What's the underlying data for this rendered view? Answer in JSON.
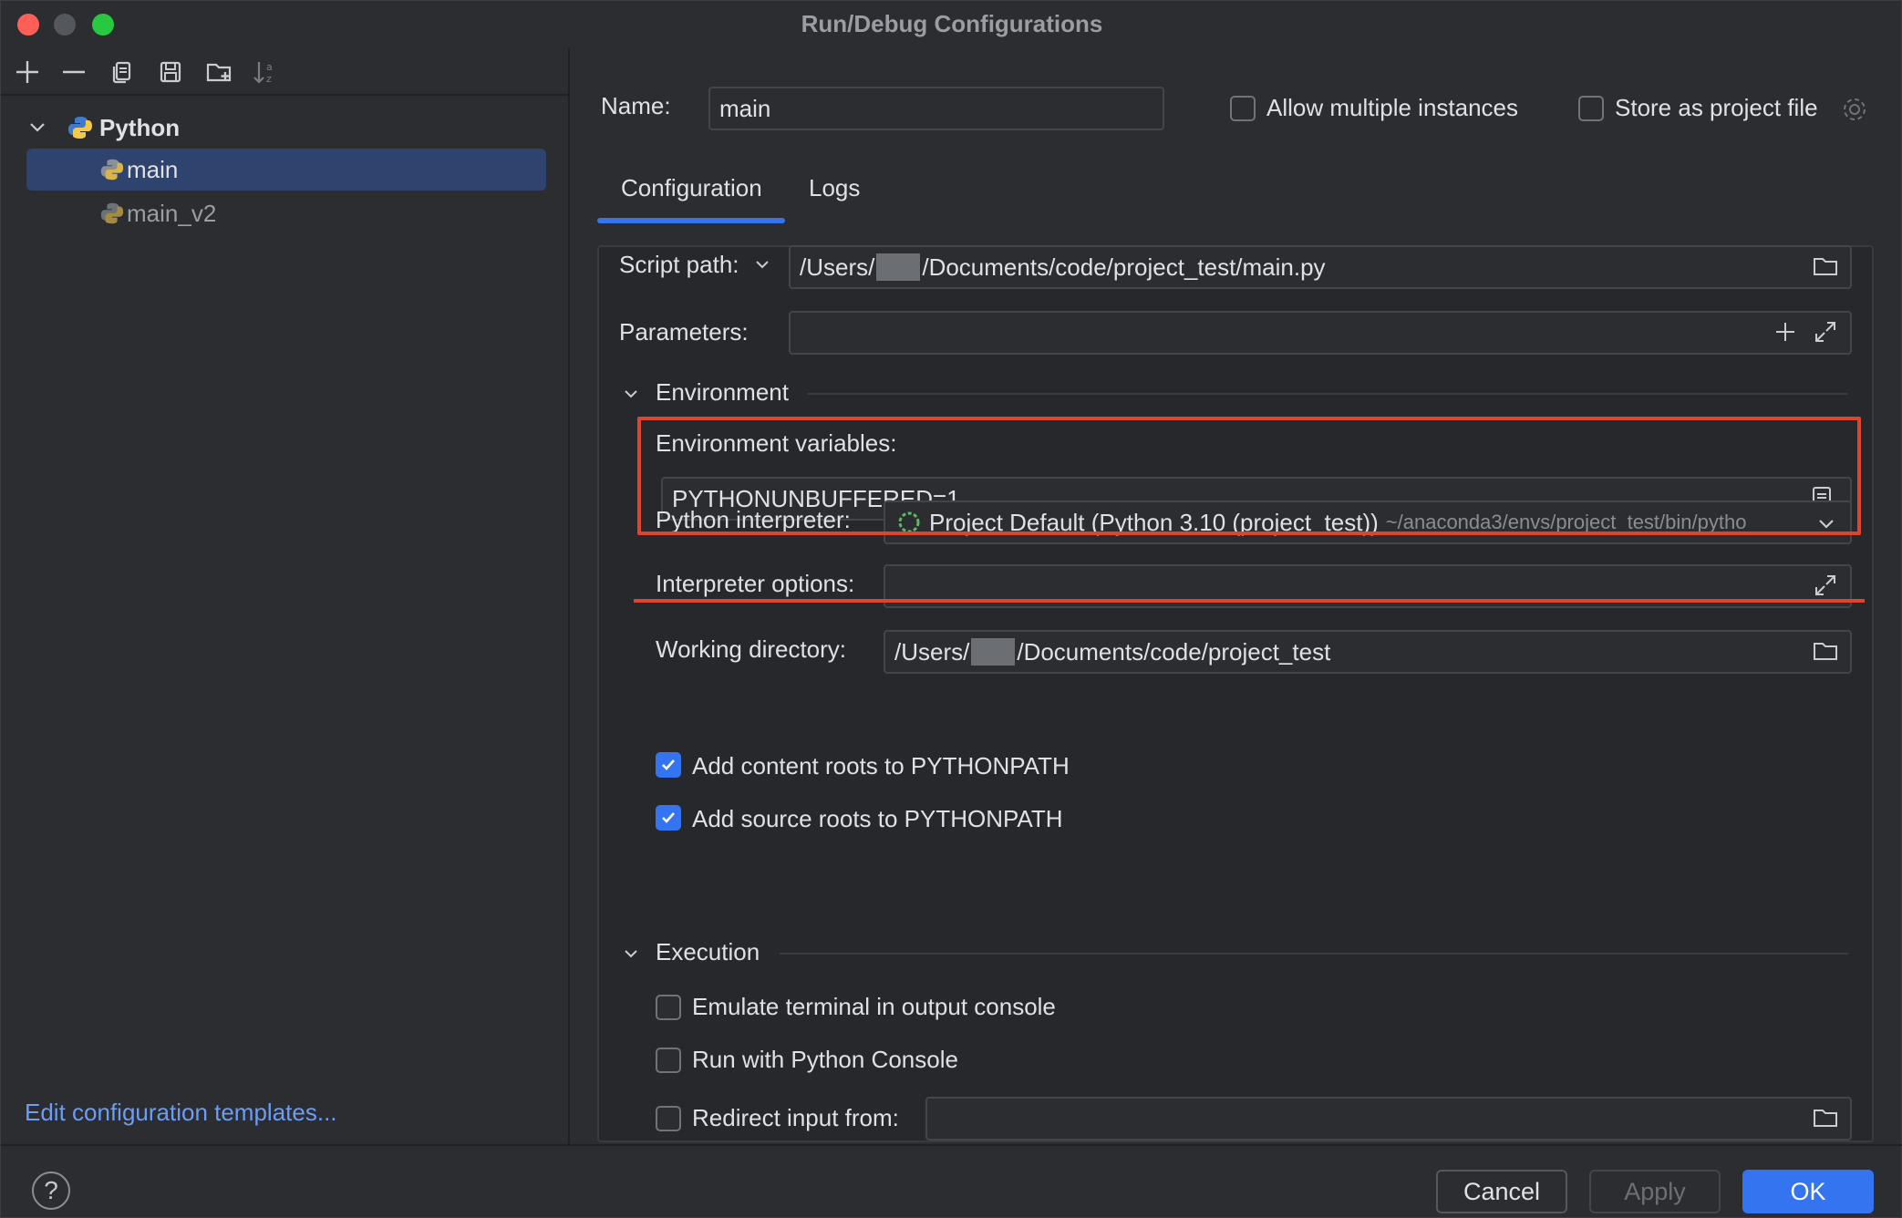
{
  "window": {
    "title": "Run/Debug Configurations"
  },
  "tree": {
    "group": "Python",
    "items": [
      {
        "label": "main",
        "selected": true
      },
      {
        "label": "main_v2",
        "selected": false
      }
    ]
  },
  "left_footer": {
    "edit_templates": "Edit configuration templates..."
  },
  "header": {
    "name_label": "Name:",
    "name_value": "main",
    "allow_multiple": {
      "label": "Allow multiple instances",
      "checked": false
    },
    "store_project": {
      "label": "Store as project file",
      "checked": false
    }
  },
  "tabs": [
    {
      "label": "Configuration",
      "active": true
    },
    {
      "label": "Logs",
      "active": false
    }
  ],
  "script": {
    "label": "Script path:",
    "value_prefix": "/Users/",
    "value_suffix": "/Documents/code/project_test/main.py"
  },
  "parameters": {
    "label": "Parameters:",
    "value": ""
  },
  "environment": {
    "section_label": "Environment",
    "env_vars_label": "Environment variables:",
    "env_vars_value": "PYTHONUNBUFFERED=1",
    "interpreter_label": "Python interpreter:",
    "interpreter_value": "Project Default (Python 3.10 (project_test))",
    "interpreter_path": "~/anaconda3/envs/project_test/bin/pytho",
    "interp_options_label": "Interpreter options:",
    "interp_options_value": "",
    "workdir_label": "Working directory:",
    "workdir_prefix": "/Users/",
    "workdir_suffix": "/Documents/code/project_test",
    "content_roots": {
      "label": "Add content roots to PYTHONPATH",
      "checked": true
    },
    "source_roots": {
      "label": "Add source roots to PYTHONPATH",
      "checked": true
    }
  },
  "execution": {
    "section_label": "Execution",
    "emulate_terminal": {
      "label": "Emulate terminal in output console",
      "checked": false
    },
    "python_console": {
      "label": "Run with Python Console",
      "checked": false
    },
    "redirect_input": {
      "label": "Redirect input from:",
      "checked": false,
      "value": ""
    }
  },
  "footer": {
    "help": "?",
    "cancel": "Cancel",
    "apply": "Apply",
    "ok": "OK"
  },
  "colors": {
    "accent": "#3574f0",
    "highlight": "#e0442e",
    "link": "#6d9cf5",
    "selection": "#2e436e"
  }
}
